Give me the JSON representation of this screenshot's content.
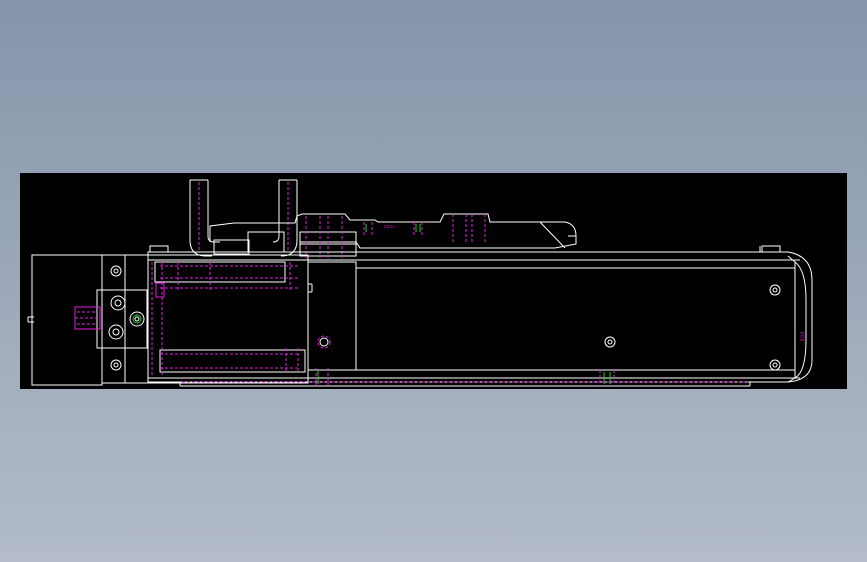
{
  "colors": {
    "background_top": "#8595ab",
    "background_bottom": "#b3bcc8",
    "viewport": "#000000",
    "line_white": "#ffffff",
    "line_magenta": "#e020e0",
    "line_green": "#20d020"
  },
  "drawing": {
    "annotations": {
      "top_plate_mark": "▭▭▭",
      "end_cap_mark": "▯▯▯"
    }
  }
}
